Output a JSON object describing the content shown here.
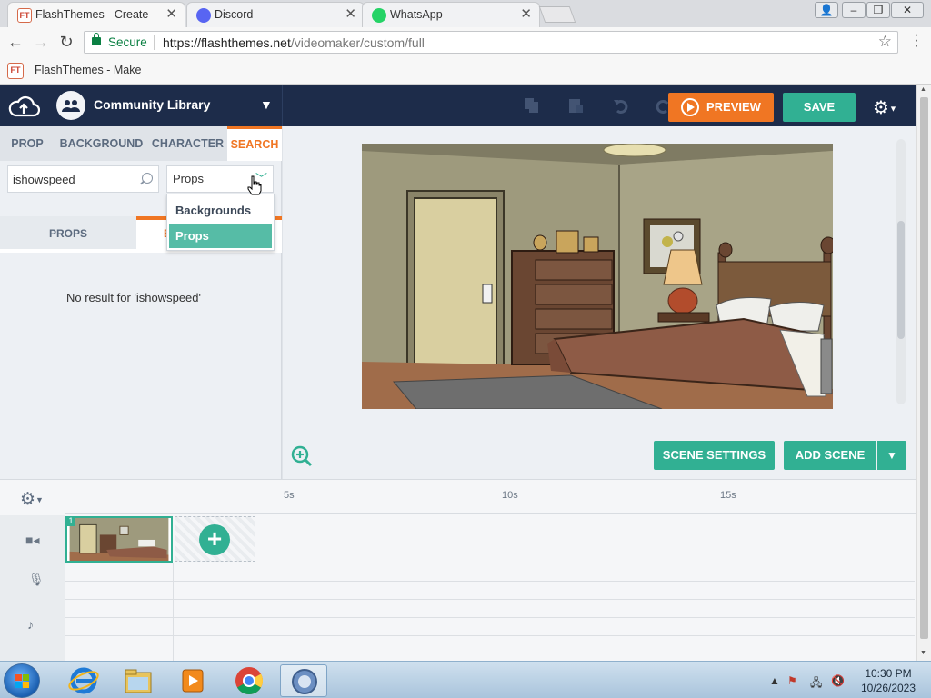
{
  "browser": {
    "tabs": [
      {
        "title": "FlashThemes - Create",
        "favicon": "flashthemes-icon",
        "active": true
      },
      {
        "title": "Discord",
        "favicon": "discord-icon",
        "active": false
      },
      {
        "title": "WhatsApp",
        "favicon": "whatsapp-icon",
        "active": false
      }
    ],
    "secure_label": "Secure",
    "url_host": "https://flashthemes.net",
    "url_path": "/videomaker/custom/full",
    "bookmark": "FlashThemes - Make"
  },
  "app": {
    "library_label": "Community Library",
    "preview_label": "PREVIEW",
    "save_label": "SAVE",
    "accent": "#f07623",
    "primary": "#31b093",
    "topbar_color": "#1d2c4a"
  },
  "left_panel": {
    "tabs": [
      "PROP",
      "BACKGROUND",
      "CHARACTER",
      "SEARCH"
    ],
    "active_tab": "SEARCH",
    "search_value": "ishowspeed",
    "type_select": "Props",
    "dropdown_options": [
      "Backgrounds",
      "Props"
    ],
    "dropdown_selected": "Props",
    "subtabs": [
      "PROPS",
      "B"
    ],
    "no_result": "No result for 'ishowspeed'"
  },
  "stage": {
    "scene_settings_label": "SCENE SETTINGS",
    "add_scene_label": "ADD SCENE"
  },
  "timeline": {
    "ticks": [
      "5s",
      "10s",
      "15s"
    ],
    "scene_number": "1"
  },
  "taskbar": {
    "time": "10:30 PM",
    "date": "10/26/2023"
  }
}
